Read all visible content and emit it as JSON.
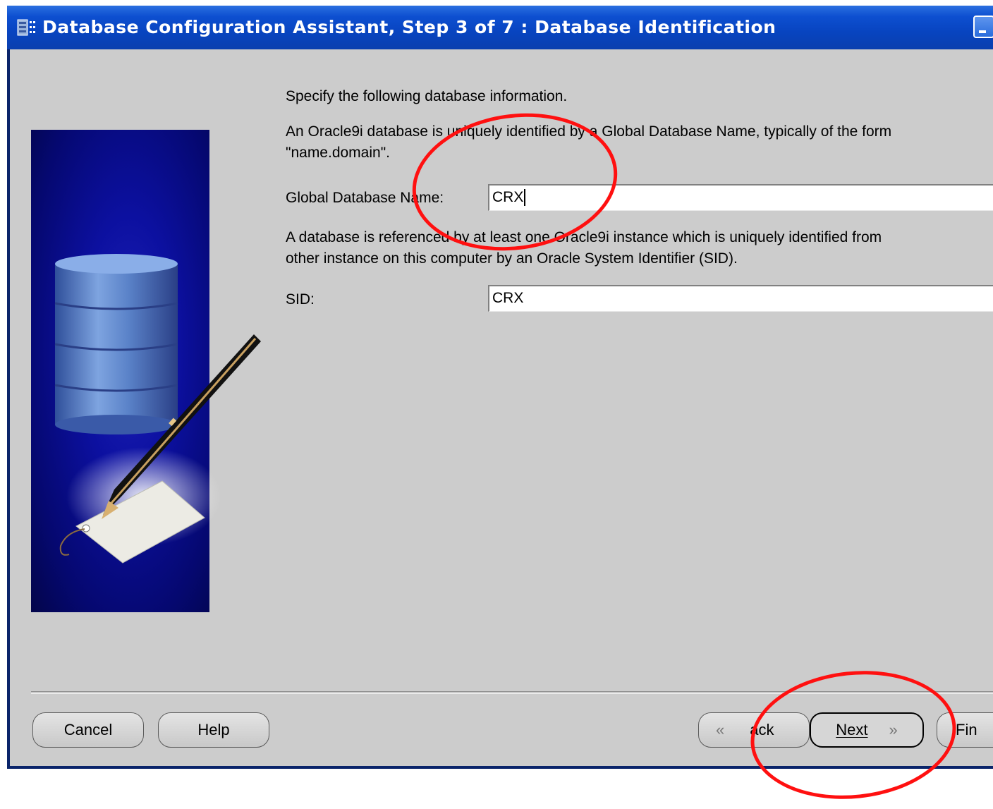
{
  "window": {
    "title": "Database Configuration Assistant, Step 3 of 7 : Database Identification"
  },
  "content": {
    "intro": "Specify the following database information.",
    "global_desc_line1": "An Oracle9i database is uniquely identified by a Global Database Name, typically of the form",
    "global_desc_line2": "\"name.domain\".",
    "global_name_label": "Global Database Name:",
    "global_name_value": "CRX",
    "sid_desc_line1": "A database is referenced by at least one Oracle9i instance which is uniquely identified from",
    "sid_desc_line2": "other instance on this computer by an Oracle System Identifier (SID).",
    "sid_label": "SID:",
    "sid_value": "CRX"
  },
  "buttons": {
    "cancel": "Cancel",
    "help": "Help",
    "back": "ack",
    "next": "Next",
    "finish": "Fin"
  },
  "icons": {
    "back_chevron": "«",
    "next_chevron": "»"
  },
  "colors": {
    "title_bar": "#0a47c4",
    "annotation_circle": "#ff1010",
    "dialog_background": "#cccccc"
  }
}
